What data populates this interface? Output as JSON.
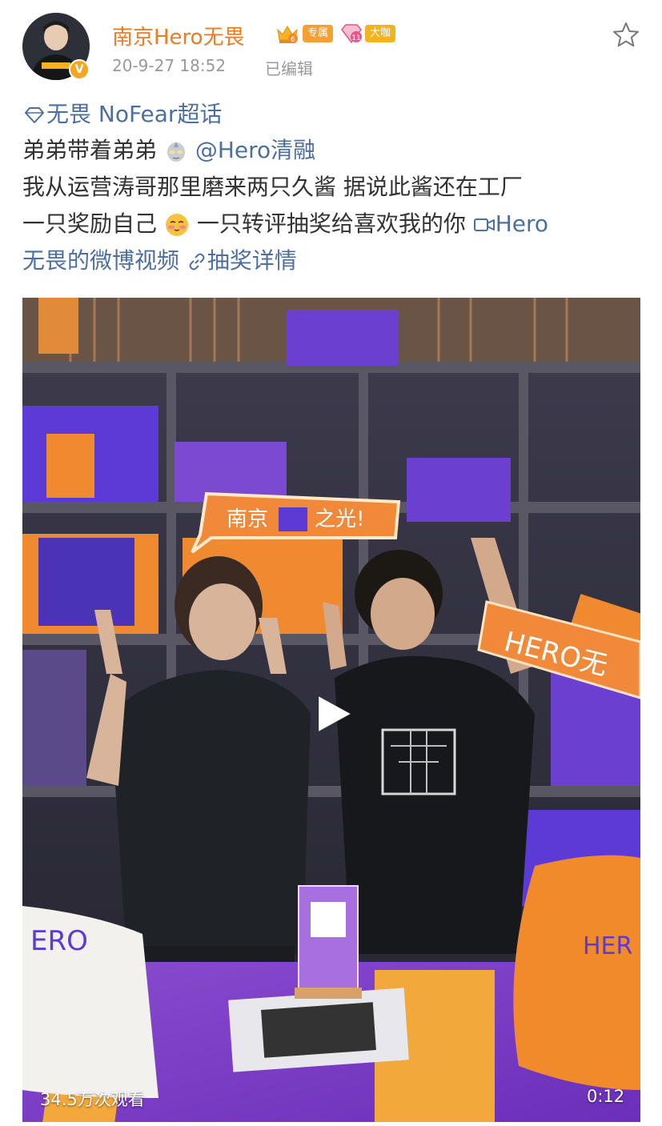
{
  "post": {
    "username": "南京Hero无畏",
    "badges": {
      "exclusive": "专属",
      "bigshot": "大咖"
    },
    "timestamp": "20-9-27 18:52",
    "edited": "已编辑",
    "topic": "无畏 NoFear超话",
    "line2_text": "弟弟带着弟弟",
    "mention": "@Hero清融",
    "line3": "我从运营涛哥那里磨来两只久酱 据说此酱还在工厂",
    "line4_a": "一只奖励自己",
    "line4_b": " 一只转评抽奖给喜欢我的你 ",
    "video_link_a": "Hero",
    "video_link_b": "无畏的微博视频",
    "lottery_link": "抽奖详情"
  },
  "video": {
    "views": "34.5万次观看",
    "duration": "0:12"
  },
  "colors": {
    "accent": "#f07a21",
    "link": "#4c6fa0",
    "meta": "#999999"
  },
  "icons": [
    "crown-icon",
    "diamond-icon",
    "star-icon",
    "verified-icon",
    "super-topic-icon",
    "ultraman-emoji",
    "blush-emoji",
    "video-icon",
    "link-icon",
    "play-icon"
  ]
}
